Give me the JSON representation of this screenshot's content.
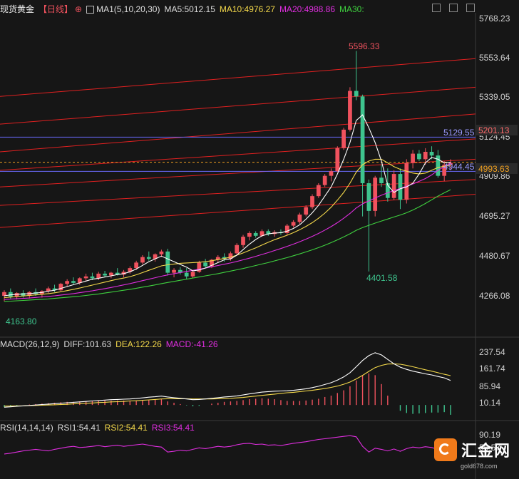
{
  "header": {
    "instrument": "现货黄金",
    "period": "【日线】",
    "ma_label": "MA1(5,10,20,30)",
    "ma5": "MA5:5012.15",
    "ma10": "MA10:4976.27",
    "ma20": "MA20:4988.86",
    "ma30": "MA30:",
    "icons": [
      "layout-icon",
      "grid-icon",
      "expand-icon"
    ]
  },
  "colors": {
    "up": "#f0525e",
    "down": "#3ec48e",
    "ma5": "#ffffff",
    "ma10": "#f4d94b",
    "ma20": "#e02ee0",
    "ma30": "#3fd13f",
    "channel": "#e02020",
    "hline": "#6b6bff",
    "price": "#f0a020"
  },
  "price_axis": {
    "ticks": [
      "5768.23",
      "5553.64",
      "5339.05",
      "5124.45",
      "4909.86",
      "4695.27",
      "4480.67",
      "4266.08"
    ],
    "hline_label": "5129.55",
    "hline2_label": "4944.45",
    "current_tag": "5201.13",
    "close_tag": "4993.63",
    "high_label": "5596.33",
    "low_label": "4401.58",
    "start_label": "4163.80"
  },
  "macd": {
    "label": "MACD(26,12,9)",
    "diff": "DIFF:101.63",
    "dea": "DEA:122.26",
    "macd": "MACD:-41.26",
    "ticks": [
      "237.54",
      "161.74",
      "85.94",
      "10.14"
    ]
  },
  "rsi": {
    "label": "RSI(14,14,14)",
    "rsi1": "RSI1:54.41",
    "rsi2": "RSI2:54.41",
    "rsi3": "RSI3:54.41",
    "ticks": [
      "90.19",
      "56.57"
    ]
  },
  "watermark": {
    "name": "汇金网",
    "url": "gold678.com"
  },
  "chart_data": {
    "type": "candlestick",
    "candles": [
      [
        4270,
        4300,
        4240,
        4290
      ],
      [
        4290,
        4310,
        4255,
        4265
      ],
      [
        4265,
        4290,
        4250,
        4285
      ],
      [
        4285,
        4300,
        4260,
        4270
      ],
      [
        4270,
        4295,
        4255,
        4290
      ],
      [
        4290,
        4310,
        4270,
        4280
      ],
      [
        4280,
        4300,
        4260,
        4295
      ],
      [
        4295,
        4320,
        4285,
        4310
      ],
      [
        4310,
        4330,
        4290,
        4300
      ],
      [
        4300,
        4340,
        4295,
        4335
      ],
      [
        4335,
        4360,
        4320,
        4350
      ],
      [
        4350,
        4370,
        4330,
        4340
      ],
      [
        4340,
        4370,
        4330,
        4365
      ],
      [
        4365,
        4390,
        4350,
        4375
      ],
      [
        4375,
        4395,
        4355,
        4365
      ],
      [
        4365,
        4400,
        4355,
        4390
      ],
      [
        4390,
        4405,
        4370,
        4380
      ],
      [
        4380,
        4400,
        4365,
        4395
      ],
      [
        4395,
        4420,
        4380,
        4385
      ],
      [
        4385,
        4410,
        4370,
        4400
      ],
      [
        4400,
        4430,
        4390,
        4420
      ],
      [
        4420,
        4460,
        4410,
        4450
      ],
      [
        4450,
        4490,
        4440,
        4480
      ],
      [
        4480,
        4510,
        4460,
        4470
      ],
      [
        4470,
        4500,
        4455,
        4495
      ],
      [
        4495,
        4520,
        4480,
        4510
      ],
      [
        4510,
        4525,
        4380,
        4395
      ],
      [
        4395,
        4420,
        4370,
        4410
      ],
      [
        4410,
        4425,
        4385,
        4395
      ],
      [
        4395,
        4420,
        4360,
        4375
      ],
      [
        4375,
        4410,
        4365,
        4400
      ],
      [
        4400,
        4460,
        4395,
        4450
      ],
      [
        4450,
        4470,
        4420,
        4430
      ],
      [
        4430,
        4470,
        4420,
        4465
      ],
      [
        4465,
        4490,
        4450,
        4480
      ],
      [
        4480,
        4500,
        4455,
        4470
      ],
      [
        4470,
        4510,
        4460,
        4500
      ],
      [
        4500,
        4555,
        4490,
        4545
      ],
      [
        4545,
        4600,
        4530,
        4590
      ],
      [
        4590,
        4620,
        4570,
        4610
      ],
      [
        4610,
        4620,
        4585,
        4595
      ],
      [
        4595,
        4630,
        4590,
        4620
      ],
      [
        4620,
        4630,
        4595,
        4605
      ],
      [
        4605,
        4625,
        4590,
        4615
      ],
      [
        4615,
        4630,
        4600,
        4610
      ],
      [
        4610,
        4660,
        4600,
        4650
      ],
      [
        4650,
        4680,
        4640,
        4670
      ],
      [
        4670,
        4720,
        4660,
        4710
      ],
      [
        4710,
        4760,
        4700,
        4750
      ],
      [
        4750,
        4820,
        4740,
        4810
      ],
      [
        4810,
        4880,
        4800,
        4870
      ],
      [
        4870,
        4930,
        4860,
        4920
      ],
      [
        4920,
        4960,
        4890,
        4945
      ],
      [
        4945,
        5080,
        4940,
        5070
      ],
      [
        5070,
        5180,
        5060,
        5170
      ],
      [
        5170,
        5400,
        5160,
        5380
      ],
      [
        5380,
        5596.33,
        5330,
        5350
      ],
      [
        5350,
        5360,
        4700,
        4880
      ],
      [
        4880,
        4900,
        4401.58,
        4730
      ],
      [
        4730,
        4920,
        4700,
        4910
      ],
      [
        4910,
        4980,
        4860,
        4880
      ],
      [
        4880,
        4960,
        4780,
        4800
      ],
      [
        4800,
        4950,
        4790,
        4930
      ],
      [
        4930,
        4960,
        4740,
        4790
      ],
      [
        4790,
        5010,
        4770,
        4990
      ],
      [
        4990,
        5060,
        4960,
        5040
      ],
      [
        5040,
        5060,
        5000,
        5010
      ],
      [
        5010,
        5070,
        4980,
        5050
      ],
      [
        5050,
        5080,
        5010,
        5030
      ],
      [
        5030,
        5060,
        4910,
        4920
      ],
      [
        4920,
        5000,
        4890,
        4980
      ],
      [
        4980,
        5010,
        4950,
        4990
      ]
    ],
    "ma5": [
      4270,
      4275,
      4278,
      4280,
      4282,
      4285,
      4288,
      4295,
      4300,
      4310,
      4320,
      4330,
      4340,
      4350,
      4360,
      4365,
      4372,
      4378,
      4385,
      4390,
      4400,
      4415,
      4435,
      4455,
      4470,
      4485,
      4470,
      4455,
      4440,
      4425,
      4405,
      4410,
      4420,
      4435,
      4450,
      4465,
      4470,
      4490,
      4520,
      4550,
      4575,
      4595,
      4605,
      4610,
      4612,
      4620,
      4635,
      4655,
      4685,
      4720,
      4760,
      4810,
      4860,
      4930,
      5010,
      5100,
      5220,
      5250,
      5180,
      5100,
      5000,
      4870,
      4830,
      4850,
      4860,
      4880,
      4930,
      4990,
      5020,
      5010,
      4990,
      4993.63
    ],
    "ma10": [
      4260,
      4263,
      4266,
      4269,
      4272,
      4275,
      4278,
      4282,
      4286,
      4292,
      4298,
      4305,
      4312,
      4320,
      4328,
      4336,
      4344,
      4352,
      4360,
      4366,
      4374,
      4384,
      4396,
      4408,
      4420,
      4432,
      4438,
      4442,
      4446,
      4448,
      4450,
      4452,
      4455,
      4460,
      4466,
      4472,
      4480,
      4490,
      4502,
      4516,
      4530,
      4545,
      4560,
      4574,
      4586,
      4598,
      4612,
      4628,
      4646,
      4666,
      4690,
      4718,
      4750,
      4788,
      4830,
      4880,
      4940,
      4980,
      5000,
      5010,
      5010,
      4990,
      4970,
      4955,
      4945,
      4935,
      4930,
      4935,
      4950,
      4965,
      4972,
      4976.27
    ],
    "ma20": [
      4250,
      4252,
      4254,
      4256,
      4258,
      4261,
      4264,
      4267,
      4270,
      4274,
      4278,
      4282,
      4287,
      4292,
      4297,
      4303,
      4309,
      4315,
      4322,
      4329,
      4336,
      4344,
      4352,
      4360,
      4368,
      4376,
      4383,
      4390,
      4396,
      4402,
      4408,
      4414,
      4420,
      4427,
      4434,
      4441,
      4448,
      4456,
      4465,
      4474,
      4484,
      4494,
      4504,
      4515,
      4526,
      4538,
      4550,
      4563,
      4577,
      4592,
      4608,
      4626,
      4645,
      4666,
      4690,
      4716,
      4746,
      4768,
      4784,
      4800,
      4815,
      4828,
      4840,
      4852,
      4864,
      4876,
      4890,
      4905,
      4925,
      4950,
      4970,
      4988.86
    ],
    "ma30": [
      4240,
      4241,
      4243,
      4245,
      4247,
      4249,
      4251,
      4253,
      4256,
      4259,
      4262,
      4265,
      4268,
      4272,
      4276,
      4280,
      4285,
      4290,
      4295,
      4300,
      4305,
      4311,
      4317,
      4323,
      4329,
      4336,
      4342,
      4348,
      4354,
      4360,
      4366,
      4372,
      4378,
      4384,
      4390,
      4397,
      4404,
      4411,
      4418,
      4426,
      4434,
      4442,
      4450,
      4459,
      4468,
      4477,
      4487,
      4497,
      4508,
      4519,
      4531,
      4544,
      4558,
      4573,
      4589,
      4606,
      4625,
      4640,
      4652,
      4664,
      4675,
      4686,
      4697,
      4708,
      4720,
      4735,
      4752,
      4770,
      4790,
      4810,
      4828,
      4845
    ],
    "macd_diff": [
      -10,
      -8,
      -6,
      -4,
      -2,
      0,
      2,
      4,
      6,
      8,
      10,
      12,
      14,
      16,
      18,
      20,
      22,
      24,
      25,
      26,
      27,
      29,
      32,
      35,
      37,
      40,
      36,
      33,
      30,
      27,
      24,
      25,
      27,
      30,
      33,
      36,
      38,
      41,
      45,
      50,
      54,
      58,
      60,
      62,
      63,
      64,
      66,
      69,
      73,
      78,
      84,
      92,
      100,
      112,
      126,
      145,
      172,
      200,
      222,
      235,
      225,
      205,
      185,
      170,
      160,
      152,
      146,
      140,
      135,
      128,
      122,
      110
    ],
    "macd_dea": [
      -5,
      -5,
      -4,
      -4,
      -3,
      -2,
      -1,
      0,
      1,
      2,
      3,
      5,
      6,
      8,
      9,
      11,
      12,
      14,
      15,
      16,
      18,
      19,
      21,
      23,
      25,
      27,
      28,
      28,
      28,
      28,
      27,
      27,
      27,
      27,
      28,
      29,
      30,
      32,
      34,
      37,
      40,
      43,
      46,
      49,
      52,
      55,
      57,
      60,
      63,
      66,
      70,
      74,
      79,
      85,
      93,
      103,
      117,
      133,
      151,
      168,
      178,
      184,
      185,
      183,
      178,
      172,
      165,
      158,
      152,
      145,
      138,
      132
    ],
    "rsi": [
      40,
      42,
      45,
      48,
      50,
      52,
      50,
      48,
      52,
      55,
      58,
      60,
      57,
      58,
      60,
      62,
      59,
      61,
      63,
      60,
      62,
      64,
      66,
      63,
      60,
      58,
      45,
      47,
      50,
      48,
      52,
      56,
      54,
      57,
      60,
      58,
      60,
      64,
      67,
      68,
      65,
      66,
      63,
      64,
      62,
      65,
      68,
      70,
      72,
      75,
      78,
      80,
      82,
      84,
      86,
      88,
      85,
      60,
      45,
      55,
      52,
      48,
      53,
      47,
      54,
      58,
      56,
      59,
      57,
      52,
      54,
      54.41
    ]
  }
}
